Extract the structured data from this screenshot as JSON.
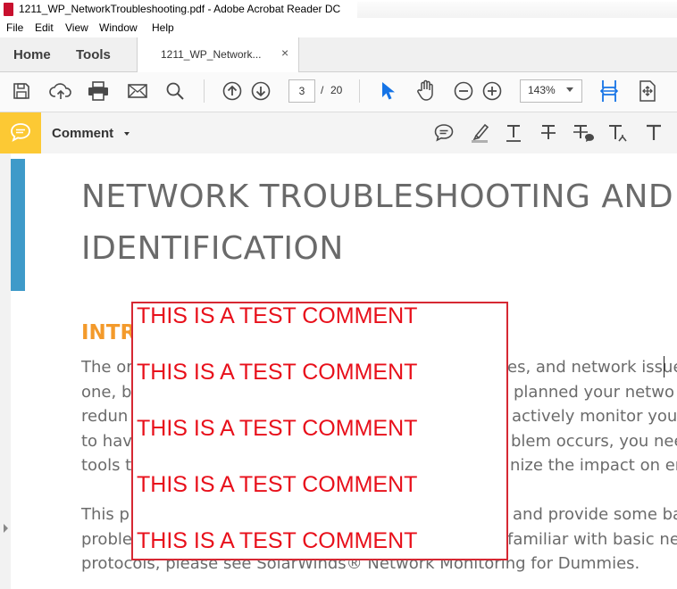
{
  "window": {
    "title": "1211_WP_NetworkTroubleshooting.pdf - Adobe Acrobat Reader DC"
  },
  "menu": [
    "File",
    "Edit",
    "View",
    "Window",
    "Help"
  ],
  "tabs": {
    "home": "Home",
    "tools": "Tools",
    "document": "1211_WP_Network...",
    "close": "×"
  },
  "toolbar": {
    "current_page": "3",
    "page_separator": "/",
    "total_pages": "20",
    "zoom": "143%",
    "icons": [
      "save-icon",
      "upload-cloud-icon",
      "print-icon",
      "email-icon",
      "search-icon",
      "page-up-icon",
      "page-down-icon",
      "select-arrow-icon",
      "hand-icon",
      "zoom-out-icon",
      "zoom-in-icon",
      "fit-width-icon",
      "fit-page-icon"
    ]
  },
  "comment_bar": {
    "label": "Comment",
    "tools": [
      "sticky-note-icon",
      "highlight-icon",
      "underline-text-icon",
      "strikethrough-text-icon",
      "replace-text-icon",
      "insert-text-icon",
      "add-text-icon"
    ]
  },
  "document": {
    "heading_lines": [
      "NETWORK TROUBLESHOOTING AND",
      "IDENTIFICATION"
    ],
    "intro_heading": "INTR",
    "body_left": [
      "The or",
      "one, b",
      "redun",
      "to hav",
      "tools t"
    ],
    "body_right": [
      "es, and network issue",
      "planned your netwo",
      "actively monitor your",
      "blem occurs, you nee",
      "nize the impact on en"
    ],
    "para2_left": [
      "This p",
      "proble"
    ],
    "para2_right": [
      "and provide some ba",
      "familiar with basic ne"
    ],
    "last_line": "protocols, please see SolarWinds® Network Monitoring for Dummies."
  },
  "comment_popup": {
    "lines": [
      "THIS IS A TEST COMMENT",
      "THIS IS A TEST COMMENT",
      "THIS IS A TEST COMMENT",
      "THIS IS A TEST COMMENT",
      "THIS IS A TEST COMMENT"
    ]
  },
  "colors": {
    "accent_blue": "#1473e6",
    "comment_yellow": "#fcc934",
    "heading_orange": "#f39a2b",
    "comment_red": "#e8101b",
    "sidebar_blue": "#3e9ac9"
  }
}
